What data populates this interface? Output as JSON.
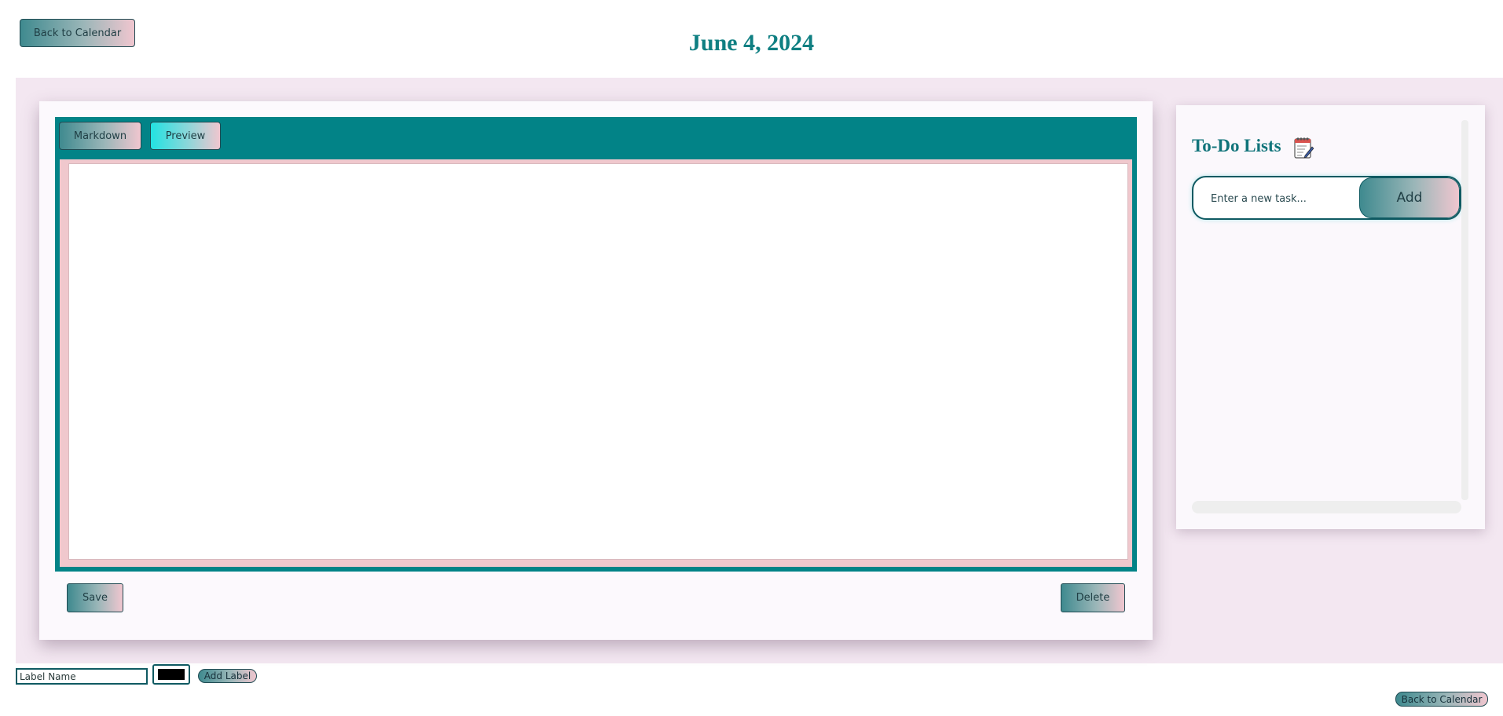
{
  "header": {
    "back_label": "Back to Calendar",
    "date_title": "June 4, 2024"
  },
  "editor": {
    "tabs": [
      {
        "label": "Markdown",
        "active": false
      },
      {
        "label": "Preview",
        "active": true
      }
    ],
    "content": "",
    "save_label": "Save",
    "delete_label": "Delete"
  },
  "todo": {
    "title": "To-Do Lists",
    "icon": "notepad-icon",
    "input_placeholder": "Enter a new task...",
    "add_label": "Add",
    "items": []
  },
  "labels": {
    "name_placeholder": "Label Name",
    "color_value": "#000000",
    "add_label": "Add Label"
  },
  "footer": {
    "back_label": "Back to Calendar"
  },
  "colors": {
    "accent_teal": "#028387",
    "title_teal": "#0f7f82",
    "background_pink": "#f3e7f1",
    "editor_pink": "#f0c8cd"
  }
}
